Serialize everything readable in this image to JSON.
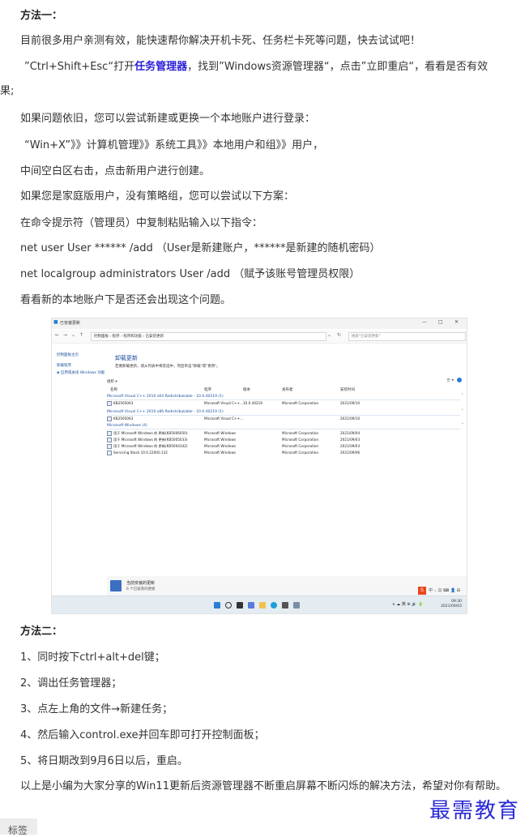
{
  "article": {
    "method1_title": "方法一：",
    "p1": "目前很多用户亲测有效，能快速帮你解决开机卡死、任务栏卡死等问题，快去试试吧！",
    "p2_pre": "”Ctrl+Shift+Esc“打开",
    "p2_link": "任务管理器",
    "p2_post": "，找到”Windows资源管理器“，点击”立即重启“，看看是否有效",
    "p2_wrap": "果;",
    "p3": "如果问题依旧，您可以尝试新建或更换一个本地账户进行登录：",
    "p4": "“Win+X”》》计算机管理》》系统工具》》本地用户和组》》用户，",
    "p5": "中间空白区右击，点击新用户进行创建。",
    "p6": "如果您是家庭版用户，没有策略组，您可以尝试以下方案：",
    "p7": "在命令提示符（管理员）中复制粘贴输入以下指令：",
    "p8": "net user User ****** /add （User是新建账户，******是新建的随机密码）",
    "p9": "net localgroup administrators User /add （赋予该账号管理员权限）",
    "p10": "看看新的本地账户下是否还会出现这个问题。",
    "method2_title": "方法二：",
    "s1": "1、同时按下ctrl+alt+del键；",
    "s2": "2、调出任务管理器；",
    "s3": "3、点左上角的文件→新建任务；",
    "s4": "4、然后输入control.exe并回车即可打开控制面板；",
    "s5": "5、将日期改到9月6日以后，重启。",
    "conclusion": "以上是小编为大家分享的Win11更新后资源管理器不断重启屏幕不断闪烁的解决方法，希望对你有帮助。"
  },
  "screenshot": {
    "window_title": "已安装更新",
    "address": "控制面板 › 程序 › 程序和功能 › 已安装更新",
    "search_placeholder": "搜索\"已安装更新\"",
    "sidebar": [
      "控制面板主页",
      "卸载程序",
      "启用或关闭 Windows 功能"
    ],
    "heading": "卸载更新",
    "subheading": "若要卸载更新，请从列表中将其选中，然后单击\"卸载\"或\"更改\"。",
    "organize": "组织 ▾",
    "columns": [
      "名称",
      "程序",
      "版本",
      "发布者",
      "安装时间"
    ],
    "groups": [
      {
        "title": "Microsoft Visual C++ 2010  x64 Redistributable - 10.0.40219 (1)",
        "rows": [
          [
            "KB2565063",
            "Microsoft Visual C++...",
            "10.0.40219",
            "Microsoft Corporation",
            "2021/09/10"
          ]
        ]
      },
      {
        "title": "Microsoft Visual C++ 2010  x86 Redistributable - 10.0.40219 (1)",
        "rows": [
          [
            "KB2565063",
            "Microsoft Visual C++...",
            "",
            "",
            "2021/09/10"
          ]
        ]
      },
      {
        "title": "Microsoft Windows (4)",
        "rows": [
          [
            "用于 Microsoft Windows 的 更新(KB5006050)",
            "Microsoft Windows",
            "",
            "Microsoft Corporation",
            "2021/09/04"
          ],
          [
            "用于 Microsoft Windows 的 更新(KB5005033)",
            "Microsoft Windows",
            "",
            "Microsoft Corporation",
            "2021/09/03"
          ],
          [
            "用于 Microsoft Windows 的 更新(KB5004342)",
            "Microsoft Windows",
            "",
            "Microsoft Corporation",
            "2021/09/03"
          ],
          [
            "Servicing Stack 10.0.22000.132",
            "Microsoft Windows",
            "",
            "Microsoft Corporation",
            "2021/09/06"
          ]
        ]
      }
    ],
    "status_title": "当前安装的更新",
    "status_sub": "6 个已安装的更新",
    "ime_label": "S",
    "ime_tools": "中 ·, ☺ ⌨ 👤 ⊞",
    "tray": "∧ ☁ 英 ⊕ 🔊 🔋",
    "clock_time": "09:30",
    "clock_date": "2021/09/03"
  },
  "watermark": "最需教育",
  "tag_label": "标签"
}
